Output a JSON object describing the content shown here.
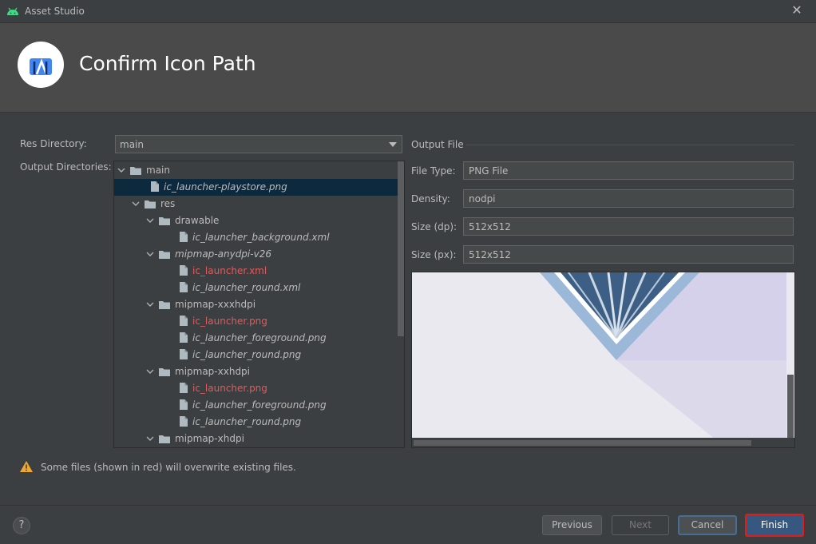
{
  "window": {
    "title": "Asset Studio",
    "close_glyph": "✕",
    "icon": "android-icon"
  },
  "header": {
    "title": "Confirm Icon Path",
    "logo": "android-studio-logo"
  },
  "form": {
    "res_directory_label": "Res Directory:",
    "res_directory_value": "main",
    "output_directories_label": "Output Directories:"
  },
  "tree": [
    {
      "label": "main",
      "type": "folder",
      "depth": 0,
      "expanded": true,
      "style": "normal"
    },
    {
      "label": "ic_launcher-playstore.png",
      "type": "file",
      "depth": 1,
      "style": "italic",
      "selected": true
    },
    {
      "label": "res",
      "type": "folder",
      "depth": 1,
      "expanded": true,
      "style": "normal"
    },
    {
      "label": "drawable",
      "type": "folder",
      "depth": 2,
      "expanded": true,
      "style": "normal"
    },
    {
      "label": "ic_launcher_background.xml",
      "type": "file",
      "depth": 3,
      "style": "italic"
    },
    {
      "label": "mipmap-anydpi-v26",
      "type": "folder",
      "depth": 2,
      "expanded": true,
      "style": "italic"
    },
    {
      "label": "ic_launcher.xml",
      "type": "file",
      "depth": 3,
      "style": "red"
    },
    {
      "label": "ic_launcher_round.xml",
      "type": "file",
      "depth": 3,
      "style": "italic"
    },
    {
      "label": "mipmap-xxxhdpi",
      "type": "folder",
      "depth": 2,
      "expanded": true,
      "style": "normal"
    },
    {
      "label": "ic_launcher.png",
      "type": "file",
      "depth": 3,
      "style": "red"
    },
    {
      "label": "ic_launcher_foreground.png",
      "type": "file",
      "depth": 3,
      "style": "italic"
    },
    {
      "label": "ic_launcher_round.png",
      "type": "file",
      "depth": 3,
      "style": "italic"
    },
    {
      "label": "mipmap-xxhdpi",
      "type": "folder",
      "depth": 2,
      "expanded": true,
      "style": "normal"
    },
    {
      "label": "ic_launcher.png",
      "type": "file",
      "depth": 3,
      "style": "red"
    },
    {
      "label": "ic_launcher_foreground.png",
      "type": "file",
      "depth": 3,
      "style": "italic"
    },
    {
      "label": "ic_launcher_round.png",
      "type": "file",
      "depth": 3,
      "style": "italic"
    },
    {
      "label": "mipmap-xhdpi",
      "type": "folder",
      "depth": 2,
      "expanded": true,
      "style": "normal"
    }
  ],
  "output_file": {
    "section_label": "Output File",
    "file_type_label": "File Type:",
    "file_type_value": "PNG File",
    "density_label": "Density:",
    "density_value": "nodpi",
    "size_dp_label": "Size (dp):",
    "size_dp_value": "512x512",
    "size_px_label": "Size (px):",
    "size_px_value": "512x512"
  },
  "warning": {
    "text": "Some files (shown in red) will overwrite existing files.",
    "icon": "warning-icon"
  },
  "buttons": {
    "help": "?",
    "previous": "Previous",
    "next": "Next",
    "cancel": "Cancel",
    "finish": "Finish"
  },
  "colors": {
    "background": "#3c3f41",
    "header": "#4a4a4a",
    "selection": "#0d293e",
    "overwrite_red": "#e25a5a",
    "finish_highlight": "#e01c1c"
  }
}
